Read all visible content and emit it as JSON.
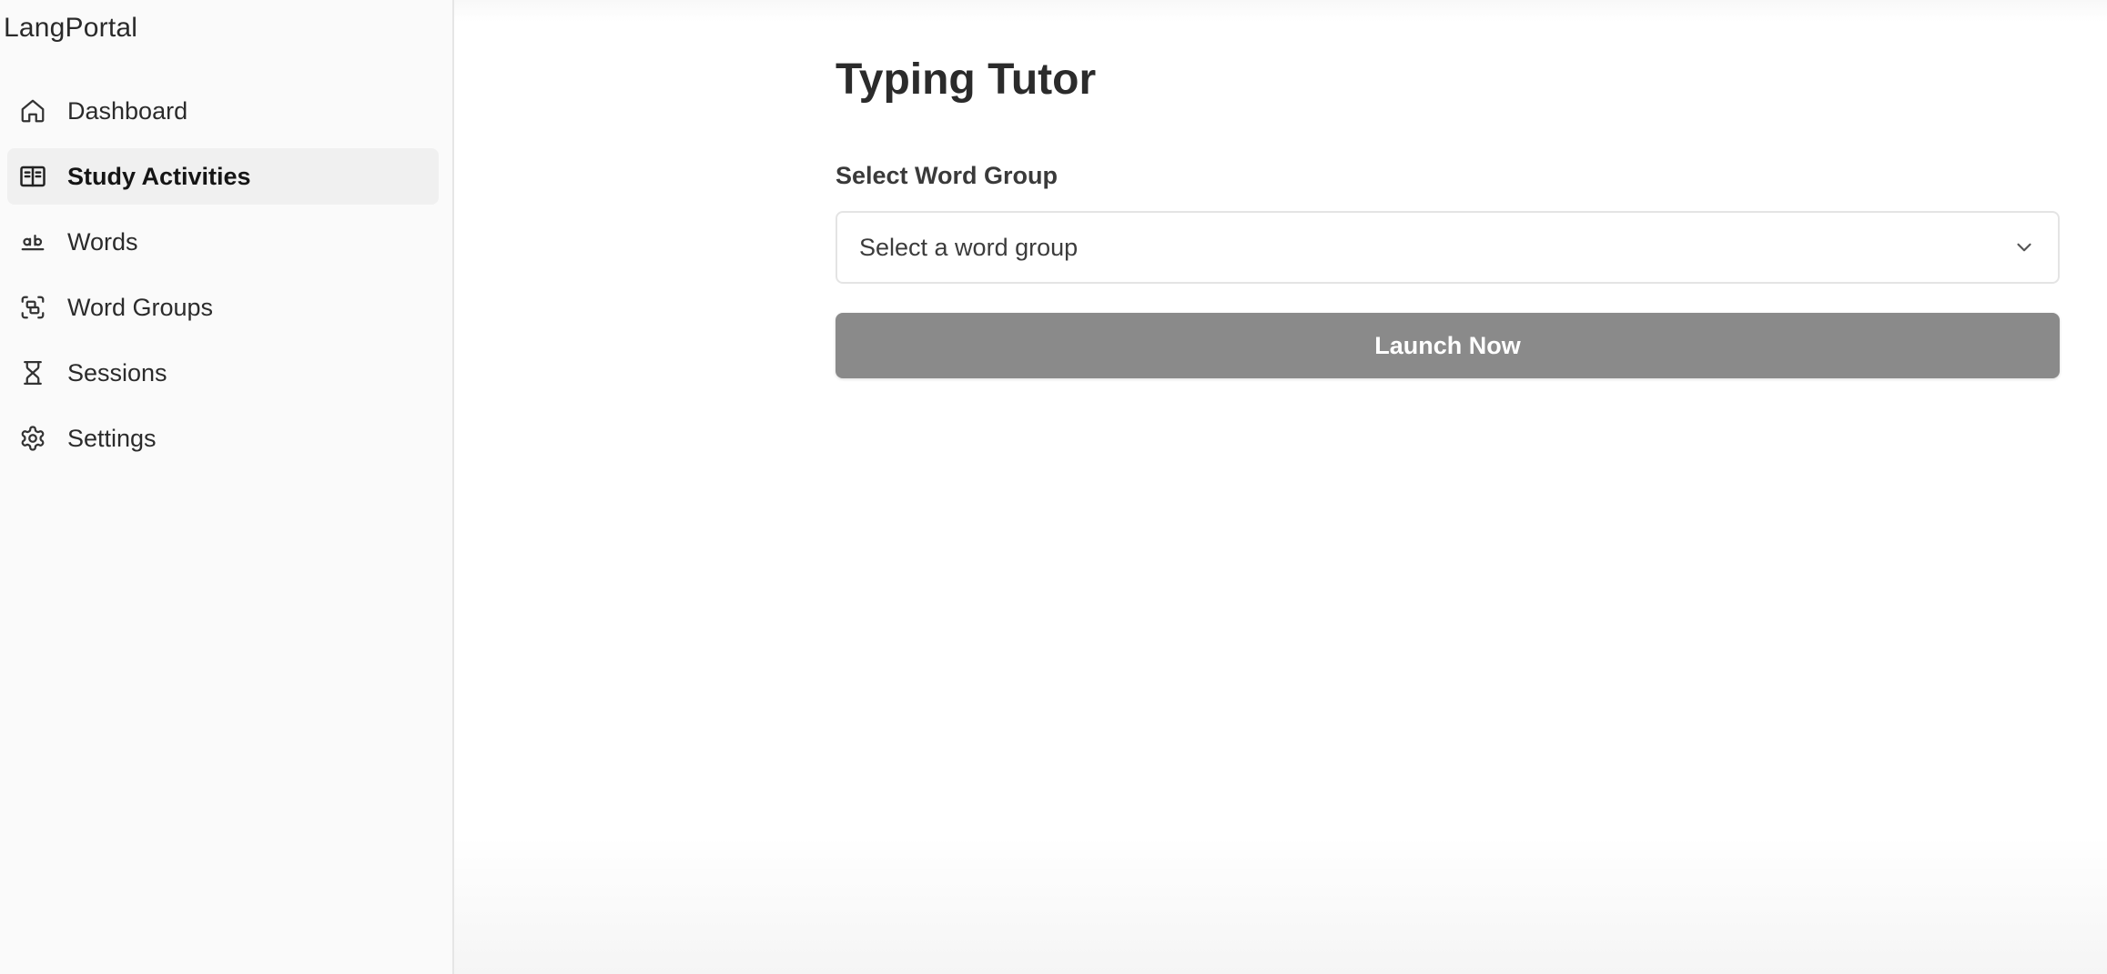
{
  "app": {
    "brand": "LangPortal"
  },
  "sidebar": {
    "items": [
      {
        "label": "Dashboard",
        "icon": "home-icon",
        "active": false
      },
      {
        "label": "Study Activities",
        "icon": "book-open-icon",
        "active": true
      },
      {
        "label": "Words",
        "icon": "whole-word-icon",
        "active": false
      },
      {
        "label": "Word Groups",
        "icon": "group-icon",
        "active": false
      },
      {
        "label": "Sessions",
        "icon": "hourglass-icon",
        "active": false
      },
      {
        "label": "Settings",
        "icon": "gear-icon",
        "active": false
      }
    ]
  },
  "main": {
    "title": "Typing Tutor",
    "word_group_label": "Select Word Group",
    "word_group_select": {
      "value": "Select a word group",
      "icon": "chevron-down-icon"
    },
    "launch_label": "Launch Now"
  },
  "colors": {
    "sidebar_bg": "#fafafa",
    "active_item_bg": "#f0f0f0",
    "button_bg": "#8a8a8a",
    "button_text": "#ffffff"
  }
}
